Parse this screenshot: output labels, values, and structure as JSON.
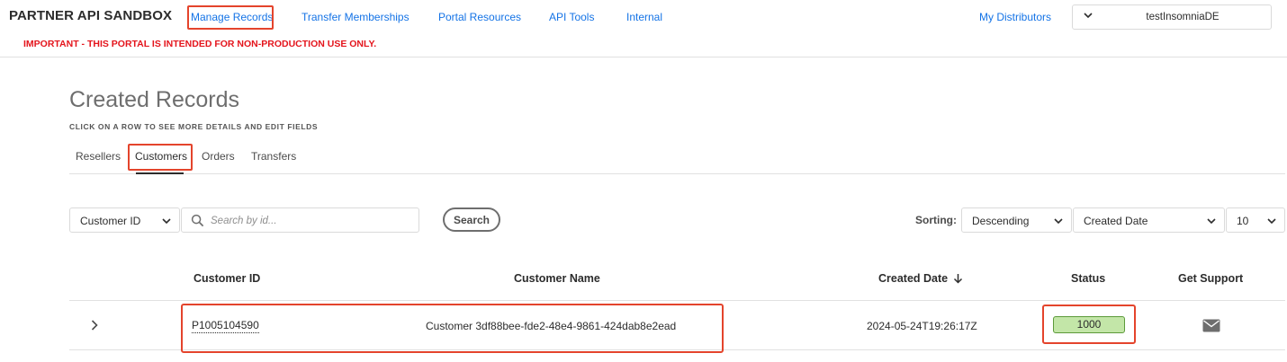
{
  "header": {
    "brand": "PARTNER API SANDBOX",
    "nav": {
      "manage_records": "Manage Records",
      "transfer_memberships": "Transfer Memberships",
      "portal_resources": "Portal Resources",
      "api_tools": "API Tools",
      "internal": "Internal",
      "my_distributors": "My Distributors"
    },
    "warning": "IMPORTANT - THIS PORTAL IS INTENDED FOR NON-PRODUCTION USE ONLY.",
    "account_select": {
      "value": "testInsomniaDE",
      "icon": "chevron-down-icon"
    }
  },
  "page": {
    "title": "Created Records",
    "subtitle": "CLICK ON A ROW TO SEE MORE DETAILS AND EDIT FIELDS",
    "tabs": [
      "Resellers",
      "Customers",
      "Orders",
      "Transfers"
    ],
    "active_tab": "Customers"
  },
  "filters": {
    "field_select": "Customer ID",
    "search_placeholder": "Search by id...",
    "search_button": "Search",
    "sorting_label": "Sorting:",
    "order_select": "Descending",
    "sort_field_select": "Created Date",
    "page_size_select": "10"
  },
  "table": {
    "columns": {
      "customer_id": "Customer ID",
      "customer_name": "Customer Name",
      "created_date": "Created Date",
      "status": "Status",
      "get_support": "Get Support"
    },
    "sort_indicator_icon": "arrow-down-icon",
    "rows": [
      {
        "customer_id": "P1005104590",
        "customer_name": "Customer 3df88bee-fde2-48e4-9861-424dab8e2ead",
        "created_date": "2024-05-24T19:26:17Z",
        "status": "1000",
        "support_icon": "mail-icon"
      }
    ]
  },
  "colors": {
    "link": "#1473e6",
    "warning": "#e4141c",
    "highlight_box": "#e4442c",
    "status_fill": "#c3e6a8",
    "status_border": "#5c9a3a"
  }
}
